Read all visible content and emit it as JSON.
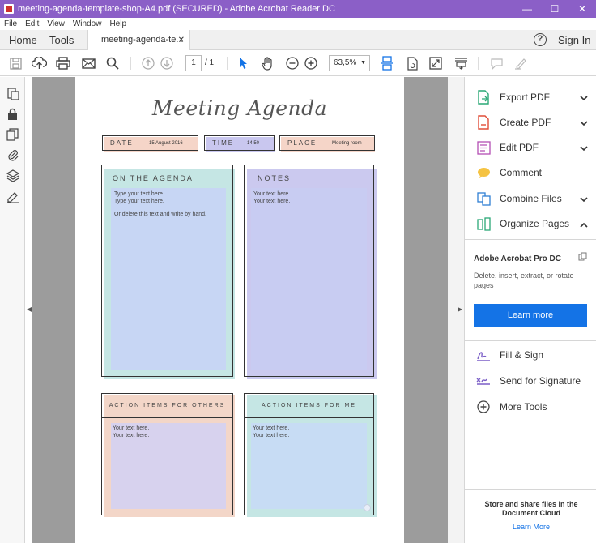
{
  "window": {
    "title": "meeting-agenda-template-shop-A4.pdf (SECURED) - Adobe Acrobat Reader DC",
    "controls": [
      "—",
      "☐",
      "✕"
    ]
  },
  "menu": [
    "File",
    "Edit",
    "View",
    "Window",
    "Help"
  ],
  "tabs": {
    "home": "Home",
    "tools": "Tools",
    "document": "meeting-agenda-te...",
    "close": "✕",
    "help": "?",
    "signin": "Sign In"
  },
  "toolbar": {
    "page_current": "1",
    "page_total": "/ 1",
    "zoom": "63,5%",
    "zoom_caret": "▼"
  },
  "document": {
    "title": "Meeting Agenda",
    "fields": [
      {
        "label": "DATE",
        "value": "15 August 2016",
        "color": "#f5d5c8"
      },
      {
        "label": "TIME",
        "value": "14:50",
        "color": "#c9c7ef"
      },
      {
        "label": "PLACE",
        "value": "Meeting room",
        "color": "#f5d5c8"
      }
    ],
    "cards": {
      "agenda": {
        "heading": "ON THE AGENDA",
        "lines": [
          "Type your text here.",
          "Type your text here.",
          "",
          "Or delete this text and write by hand."
        ],
        "color": "#c5e6e4",
        "inner_color": "#c7d6f4"
      },
      "notes": {
        "heading": "NOTES",
        "lines": [
          "Your text here.",
          "Your text here."
        ],
        "color": "#cbc9ef",
        "inner_color": "#c8ccf2"
      },
      "others": {
        "heading": "ACTION ITEMS FOR OTHERS",
        "lines": [
          "Your text here.",
          "Your text here."
        ],
        "color": "#f3d6c8",
        "inner_color": "#d7d2ee"
      },
      "me": {
        "heading": "ACTION ITEMS FOR ME",
        "lines": [
          "Your text here.",
          "Your text here."
        ],
        "color": "#c5e6e4",
        "inner_color": "#c7dcf4"
      }
    }
  },
  "right_panel": {
    "tools": [
      {
        "label": "Export PDF",
        "icon": "export-pdf-icon",
        "chevron": "down"
      },
      {
        "label": "Create PDF",
        "icon": "create-pdf-icon",
        "chevron": "down"
      },
      {
        "label": "Edit PDF",
        "icon": "edit-pdf-icon",
        "chevron": "down"
      },
      {
        "label": "Comment",
        "icon": "comment-icon",
        "chevron": ""
      },
      {
        "label": "Combine Files",
        "icon": "combine-files-icon",
        "chevron": "down"
      },
      {
        "label": "Organize Pages",
        "icon": "organize-pages-icon",
        "chevron": "up"
      }
    ],
    "promo": {
      "title": "Adobe Acrobat Pro DC",
      "description": "Delete, insert, extract, or rotate pages",
      "button": "Learn more"
    },
    "more_tools": [
      {
        "label": "Fill & Sign",
        "icon": "fill-sign-icon"
      },
      {
        "label": "Send for Signature",
        "icon": "send-signature-icon"
      },
      {
        "label": "More Tools",
        "icon": "more-tools-icon"
      }
    ],
    "store": {
      "text": "Store and share files in the Document Cloud",
      "link": "Learn More"
    }
  },
  "colors": {
    "titlebar": "#8b5fc7",
    "accent_blue": "#1473e6"
  }
}
